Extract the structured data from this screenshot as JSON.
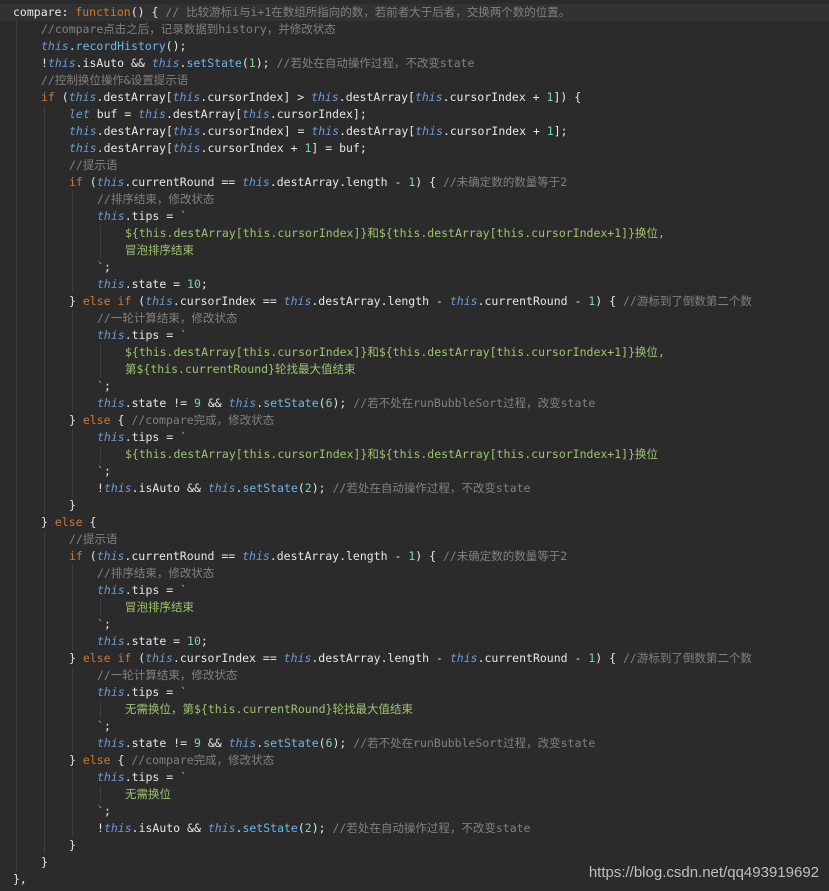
{
  "editor": {
    "lines": [
      {
        "indent": 0,
        "current": true,
        "tokens": [
          [
            "op",
            "compare: "
          ],
          [
            "kw",
            "function"
          ],
          [
            "op",
            "() { "
          ],
          [
            "cm",
            "// 比较游标i与i+1在数组所指向的数，若前者大于后者，交换两个数的位置。"
          ]
        ]
      },
      {
        "indent": 1,
        "tokens": [
          [
            "cm",
            "//compare点击之后，记录数据到history，并修改状态"
          ]
        ]
      },
      {
        "indent": 1,
        "tokens": [
          [
            "th",
            "this"
          ],
          [
            "op",
            "."
          ],
          [
            "fn",
            "recordHistory"
          ],
          [
            "op",
            "();"
          ]
        ]
      },
      {
        "indent": 1,
        "tokens": [
          [
            "op",
            "!"
          ],
          [
            "th",
            "this"
          ],
          [
            "op",
            ".isAuto && "
          ],
          [
            "th",
            "this"
          ],
          [
            "op",
            "."
          ],
          [
            "fn",
            "setState"
          ],
          [
            "op",
            "("
          ],
          [
            "num",
            "1"
          ],
          [
            "op",
            "); "
          ],
          [
            "cm",
            "//若处在自动操作过程，不改变state"
          ]
        ]
      },
      {
        "indent": 1,
        "tokens": [
          [
            "cm",
            "//控制换位操作&设置提示语"
          ]
        ]
      },
      {
        "indent": 1,
        "tokens": [
          [
            "kw",
            "if"
          ],
          [
            "op",
            " ("
          ],
          [
            "th",
            "this"
          ],
          [
            "op",
            ".destArray["
          ],
          [
            "th",
            "this"
          ],
          [
            "op",
            ".cursorIndex] > "
          ],
          [
            "th",
            "this"
          ],
          [
            "op",
            ".destArray["
          ],
          [
            "th",
            "this"
          ],
          [
            "op",
            ".cursorIndex + "
          ],
          [
            "num",
            "1"
          ],
          [
            "op",
            "]) {"
          ]
        ]
      },
      {
        "indent": 2,
        "tokens": [
          [
            "th",
            "let"
          ],
          [
            "op",
            " buf = "
          ],
          [
            "th",
            "this"
          ],
          [
            "op",
            ".destArray["
          ],
          [
            "th",
            "this"
          ],
          [
            "op",
            ".cursorIndex];"
          ]
        ]
      },
      {
        "indent": 2,
        "tokens": [
          [
            "th",
            "this"
          ],
          [
            "op",
            ".destArray["
          ],
          [
            "th",
            "this"
          ],
          [
            "op",
            ".cursorIndex] = "
          ],
          [
            "th",
            "this"
          ],
          [
            "op",
            ".destArray["
          ],
          [
            "th",
            "this"
          ],
          [
            "op",
            ".cursorIndex + "
          ],
          [
            "num",
            "1"
          ],
          [
            "op",
            "];"
          ]
        ]
      },
      {
        "indent": 2,
        "tokens": [
          [
            "th",
            "this"
          ],
          [
            "op",
            ".destArray["
          ],
          [
            "th",
            "this"
          ],
          [
            "op",
            ".cursorIndex + "
          ],
          [
            "num",
            "1"
          ],
          [
            "op",
            "] = buf;"
          ]
        ]
      },
      {
        "indent": 2,
        "tokens": [
          [
            "cm",
            "//提示语"
          ]
        ]
      },
      {
        "indent": 2,
        "tokens": [
          [
            "kw",
            "if"
          ],
          [
            "op",
            " ("
          ],
          [
            "th",
            "this"
          ],
          [
            "op",
            ".currentRound == "
          ],
          [
            "th",
            "this"
          ],
          [
            "op",
            ".destArray.length - "
          ],
          [
            "num",
            "1"
          ],
          [
            "op",
            ") { "
          ],
          [
            "cm",
            "//未确定数的数量等于2"
          ]
        ]
      },
      {
        "indent": 3,
        "tokens": [
          [
            "cm",
            "//排序结束，修改状态"
          ]
        ]
      },
      {
        "indent": 3,
        "tokens": [
          [
            "th",
            "this"
          ],
          [
            "op",
            ".tips = "
          ],
          [
            "tp",
            "`"
          ]
        ]
      },
      {
        "indent": 4,
        "tokens": [
          [
            "tp",
            "${this.destArray[this.cursorIndex]}和${this.destArray[this.cursorIndex+1]}换位,"
          ]
        ]
      },
      {
        "indent": 4,
        "tokens": [
          [
            "tp",
            "冒泡排序结束"
          ]
        ]
      },
      {
        "indent": 3,
        "tokens": [
          [
            "tp",
            "`"
          ],
          [
            "op",
            ";"
          ]
        ]
      },
      {
        "indent": 3,
        "tokens": [
          [
            "th",
            "this"
          ],
          [
            "op",
            ".state = "
          ],
          [
            "num",
            "10"
          ],
          [
            "op",
            ";"
          ]
        ]
      },
      {
        "indent": 2,
        "tokens": [
          [
            "op",
            "} "
          ],
          [
            "kw",
            "else if"
          ],
          [
            "op",
            " ("
          ],
          [
            "th",
            "this"
          ],
          [
            "op",
            ".cursorIndex == "
          ],
          [
            "th",
            "this"
          ],
          [
            "op",
            ".destArray.length - "
          ],
          [
            "th",
            "this"
          ],
          [
            "op",
            ".currentRound - "
          ],
          [
            "num",
            "1"
          ],
          [
            "op",
            ") { "
          ],
          [
            "cm",
            "//游标到了倒数第二个数"
          ]
        ]
      },
      {
        "indent": 3,
        "tokens": [
          [
            "cm",
            "//一轮计算结束，修改状态"
          ]
        ]
      },
      {
        "indent": 3,
        "tokens": [
          [
            "th",
            "this"
          ],
          [
            "op",
            ".tips = "
          ],
          [
            "tp",
            "`"
          ]
        ]
      },
      {
        "indent": 4,
        "tokens": [
          [
            "tp",
            "${this.destArray[this.cursorIndex]}和${this.destArray[this.cursorIndex+1]}换位,"
          ]
        ]
      },
      {
        "indent": 4,
        "tokens": [
          [
            "tp",
            "第${this.currentRound}轮找最大值结束"
          ]
        ]
      },
      {
        "indent": 3,
        "tokens": [
          [
            "tp",
            "`"
          ],
          [
            "op",
            ";"
          ]
        ]
      },
      {
        "indent": 3,
        "tokens": [
          [
            "th",
            "this"
          ],
          [
            "op",
            ".state != "
          ],
          [
            "num",
            "9"
          ],
          [
            "op",
            " && "
          ],
          [
            "th",
            "this"
          ],
          [
            "op",
            "."
          ],
          [
            "fn",
            "setState"
          ],
          [
            "op",
            "("
          ],
          [
            "num",
            "6"
          ],
          [
            "op",
            "); "
          ],
          [
            "cm",
            "//若不处在runBubbleSort过程，改变state"
          ]
        ]
      },
      {
        "indent": 2,
        "tokens": [
          [
            "op",
            "} "
          ],
          [
            "kw",
            "else"
          ],
          [
            "op",
            " { "
          ],
          [
            "cm",
            "//compare完成，修改状态"
          ]
        ]
      },
      {
        "indent": 3,
        "tokens": [
          [
            "th",
            "this"
          ],
          [
            "op",
            ".tips = "
          ],
          [
            "tp",
            "`"
          ]
        ]
      },
      {
        "indent": 4,
        "tokens": [
          [
            "tp",
            "${this.destArray[this.cursorIndex]}和${this.destArray[this.cursorIndex+1]}换位"
          ]
        ]
      },
      {
        "indent": 3,
        "tokens": [
          [
            "tp",
            "`"
          ],
          [
            "op",
            ";"
          ]
        ]
      },
      {
        "indent": 3,
        "tokens": [
          [
            "op",
            "!"
          ],
          [
            "th",
            "this"
          ],
          [
            "op",
            ".isAuto && "
          ],
          [
            "th",
            "this"
          ],
          [
            "op",
            "."
          ],
          [
            "fn",
            "setState"
          ],
          [
            "op",
            "("
          ],
          [
            "num",
            "2"
          ],
          [
            "op",
            "); "
          ],
          [
            "cm",
            "//若处在自动操作过程，不改变state"
          ]
        ]
      },
      {
        "indent": 2,
        "tokens": [
          [
            "op",
            "}"
          ]
        ]
      },
      {
        "indent": 1,
        "tokens": [
          [
            "op",
            "} "
          ],
          [
            "kw",
            "else"
          ],
          [
            "op",
            " {"
          ]
        ]
      },
      {
        "indent": 2,
        "tokens": [
          [
            "cm",
            "//提示语"
          ]
        ]
      },
      {
        "indent": 2,
        "tokens": [
          [
            "kw",
            "if"
          ],
          [
            "op",
            " ("
          ],
          [
            "th",
            "this"
          ],
          [
            "op",
            ".currentRound == "
          ],
          [
            "th",
            "this"
          ],
          [
            "op",
            ".destArray.length - "
          ],
          [
            "num",
            "1"
          ],
          [
            "op",
            ") { "
          ],
          [
            "cm",
            "//未确定数的数量等于2"
          ]
        ]
      },
      {
        "indent": 3,
        "tokens": [
          [
            "cm",
            "//排序结束，修改状态"
          ]
        ]
      },
      {
        "indent": 3,
        "tokens": [
          [
            "th",
            "this"
          ],
          [
            "op",
            ".tips = "
          ],
          [
            "tp",
            "`"
          ]
        ]
      },
      {
        "indent": 4,
        "tokens": [
          [
            "tp",
            "冒泡排序结束"
          ]
        ]
      },
      {
        "indent": 3,
        "tokens": [
          [
            "tp",
            "`"
          ],
          [
            "op",
            ";"
          ]
        ]
      },
      {
        "indent": 3,
        "tokens": [
          [
            "th",
            "this"
          ],
          [
            "op",
            ".state = "
          ],
          [
            "num",
            "10"
          ],
          [
            "op",
            ";"
          ]
        ]
      },
      {
        "indent": 2,
        "tokens": [
          [
            "op",
            "} "
          ],
          [
            "kw",
            "else if"
          ],
          [
            "op",
            " ("
          ],
          [
            "th",
            "this"
          ],
          [
            "op",
            ".cursorIndex == "
          ],
          [
            "th",
            "this"
          ],
          [
            "op",
            ".destArray.length - "
          ],
          [
            "th",
            "this"
          ],
          [
            "op",
            ".currentRound - "
          ],
          [
            "num",
            "1"
          ],
          [
            "op",
            ") { "
          ],
          [
            "cm",
            "//游标到了倒数第二个数"
          ]
        ]
      },
      {
        "indent": 3,
        "tokens": [
          [
            "cm",
            "//一轮计算结束，修改状态"
          ]
        ]
      },
      {
        "indent": 3,
        "tokens": [
          [
            "th",
            "this"
          ],
          [
            "op",
            ".tips = "
          ],
          [
            "tp",
            "`"
          ]
        ]
      },
      {
        "indent": 4,
        "tokens": [
          [
            "tp",
            "无需换位，第${this.currentRound}轮找最大值结束"
          ]
        ]
      },
      {
        "indent": 3,
        "tokens": [
          [
            "tp",
            "`"
          ],
          [
            "op",
            ";"
          ]
        ]
      },
      {
        "indent": 3,
        "tokens": [
          [
            "th",
            "this"
          ],
          [
            "op",
            ".state != "
          ],
          [
            "num",
            "9"
          ],
          [
            "op",
            " && "
          ],
          [
            "th",
            "this"
          ],
          [
            "op",
            "."
          ],
          [
            "fn",
            "setState"
          ],
          [
            "op",
            "("
          ],
          [
            "num",
            "6"
          ],
          [
            "op",
            "); "
          ],
          [
            "cm",
            "//若不处在runBubbleSort过程，改变state"
          ]
        ]
      },
      {
        "indent": 2,
        "tokens": [
          [
            "op",
            "} "
          ],
          [
            "kw",
            "else"
          ],
          [
            "op",
            " { "
          ],
          [
            "cm",
            "//compare完成，修改状态"
          ]
        ]
      },
      {
        "indent": 3,
        "tokens": [
          [
            "th",
            "this"
          ],
          [
            "op",
            ".tips = "
          ],
          [
            "tp",
            "`"
          ]
        ]
      },
      {
        "indent": 4,
        "tokens": [
          [
            "tp",
            "无需换位"
          ]
        ]
      },
      {
        "indent": 3,
        "tokens": [
          [
            "tp",
            "`"
          ],
          [
            "op",
            ";"
          ]
        ]
      },
      {
        "indent": 3,
        "tokens": [
          [
            "op",
            "!"
          ],
          [
            "th",
            "this"
          ],
          [
            "op",
            ".isAuto && "
          ],
          [
            "th",
            "this"
          ],
          [
            "op",
            "."
          ],
          [
            "fn",
            "setState"
          ],
          [
            "op",
            "("
          ],
          [
            "num",
            "2"
          ],
          [
            "op",
            "); "
          ],
          [
            "cm",
            "//若处在自动操作过程，不改变state"
          ]
        ]
      },
      {
        "indent": 2,
        "tokens": [
          [
            "op",
            "}"
          ]
        ]
      },
      {
        "indent": 1,
        "tokens": [
          [
            "op",
            "}"
          ]
        ]
      },
      {
        "indent": 0,
        "tokens": [
          [
            "op",
            "},"
          ]
        ]
      }
    ]
  },
  "watermark": "https://blog.csdn.net/qq493919692"
}
